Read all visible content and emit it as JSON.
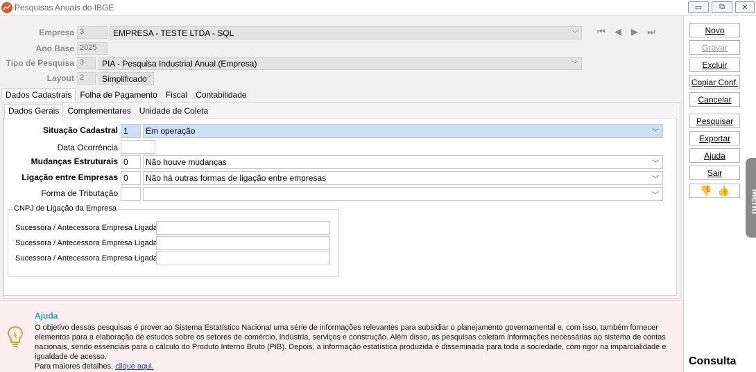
{
  "window": {
    "title": "Pesquisas Anuais do IBGE"
  },
  "header": {
    "empresa_label": "Empresa",
    "empresa_code": "3",
    "empresa_name": "EMPRESA - TESTE LTDA - SQL",
    "ano_base_label": "Ano Base",
    "ano_base_value": "2025",
    "tipo_label": "Tipo de Pesquisa",
    "tipo_code": "3",
    "tipo_value": "PIA - Pesquisa Industrial Anual (Empresa)",
    "layout_label": "Layout",
    "layout_code": "2",
    "layout_value": "Simplificado"
  },
  "tabs": [
    "Dados Cadastrais",
    "Folha de Pagamento",
    "Fiscal",
    "Contabilidade"
  ],
  "subtabs": [
    "Dados Gerais",
    "Complementares",
    "Unidade de Coleta"
  ],
  "form": {
    "situacao": {
      "label": "Situação Cadastral",
      "code": "1",
      "value": "Em operação"
    },
    "data_ocorrencia": {
      "label": "Data Ocorrência",
      "value": ""
    },
    "mudancas": {
      "label": "Mudanças Estruturais",
      "code": "0",
      "value": "Não houve mudanças"
    },
    "ligacao": {
      "label": "Ligação entre Empresas",
      "code": "0",
      "value": "Não há outras formas de ligação entre empresas"
    },
    "tributacao": {
      "label": "Forma de Tributação",
      "code": "",
      "value": ""
    }
  },
  "cnpj_group": {
    "title": "CNPJ de Ligação da Empresa",
    "rows": [
      {
        "label": "Sucessora / Antecessora Empresa Ligada",
        "value": ""
      },
      {
        "label": "Sucessora / Antecessora Empresa Ligada",
        "value": ""
      },
      {
        "label": "Sucessora / Antecessora Empresa Ligada",
        "value": ""
      }
    ]
  },
  "actions": {
    "novo": "Novo",
    "gravar": "Gravar",
    "excluir": "Excluir",
    "copiar": "Copiar Conf.",
    "cancelar": "Cancelar",
    "pesquisar": "Pesquisar",
    "exportar": "Exportar",
    "ajuda": "Ajuda",
    "sair": "Sair"
  },
  "menu_tab": "Menu",
  "mode": "Consulta",
  "help": {
    "title": "Ajuda",
    "text": "O objetivo dessas pesquisas é prover ao Sistema Estatístico Nacional uma série de informações relevantes para subsidiar o planejamento governamental e, com isso, também fornecer elementos para a elaboração de estudos sobre os setores de comércio, indústria, serviços e construção. Além disso, as pesquisas coletam informações necessárias ao sistema de contas nacionais, sendo essenciais para o cálculo do Produto Interno Bruto (PIB). Depois, a informação estatística produzida é disseminada para toda a sociedade, com rigor na imparcialidade e igualdade de acesso.",
    "more_prefix": "Para maiores detalhes,",
    "link": "clique aqui."
  },
  "colors": {
    "accent": "#2aa4b4",
    "selection": "#cce0f7",
    "help_bg": "#fbeef1",
    "thumbs": "#e65aa4"
  }
}
